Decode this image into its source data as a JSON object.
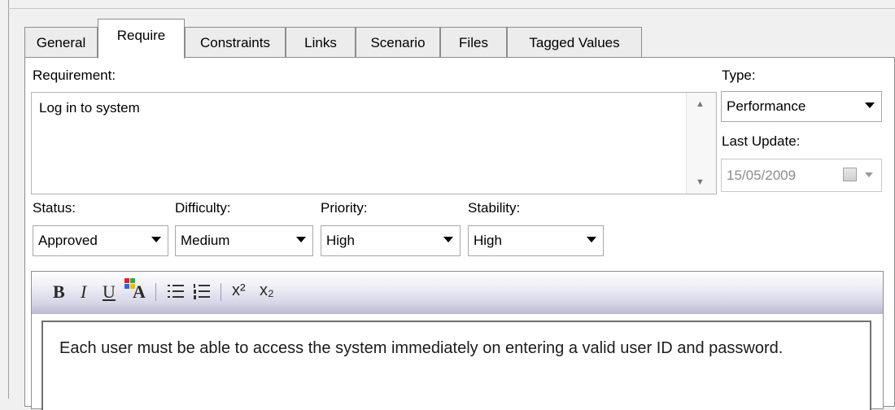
{
  "tabs": [
    {
      "label": "General",
      "active": false
    },
    {
      "label": "Require",
      "active": true
    },
    {
      "label": "Constraints",
      "active": false
    },
    {
      "label": "Links",
      "active": false
    },
    {
      "label": "Scenario",
      "active": false
    },
    {
      "label": "Files",
      "active": false
    },
    {
      "label": "Tagged Values",
      "active": false
    }
  ],
  "requirement": {
    "label": "Requirement:",
    "value": "Log in to system"
  },
  "type": {
    "label": "Type:",
    "value": "Performance"
  },
  "last_update": {
    "label": "Last Update:",
    "value": "15/05/2009"
  },
  "status": {
    "label": "Status:",
    "value": "Approved"
  },
  "difficulty": {
    "label": "Difficulty:",
    "value": "Medium"
  },
  "priority": {
    "label": "Priority:",
    "value": "High"
  },
  "stability": {
    "label": "Stability:",
    "value": "High"
  },
  "toolbar": {
    "bold": "B",
    "italic": "I",
    "underline": "U",
    "font_color": "A",
    "superscript": "x²",
    "subscript": "x₂",
    "icons": [
      "bold-icon",
      "italic-icon",
      "underline-icon",
      "font-color-icon",
      "bullet-list-icon",
      "numbered-list-icon",
      "superscript-icon",
      "subscript-icon"
    ]
  },
  "notes": {
    "text": "Each user must be able to access the system immediately on entering a valid user ID and password."
  }
}
